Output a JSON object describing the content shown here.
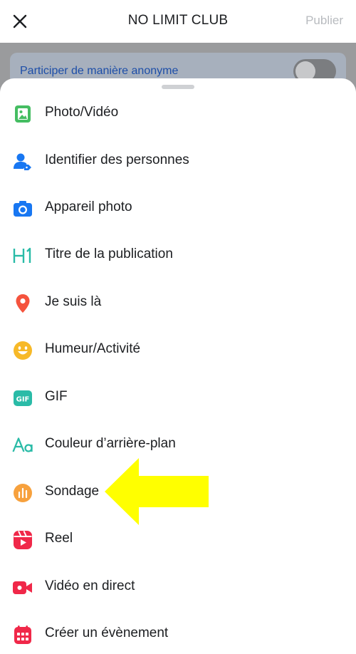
{
  "header": {
    "title": "NO LIMIT CLUB",
    "publish_label": "Publier"
  },
  "anonymous": {
    "label": "Participer de manière anonyme",
    "enabled": false
  },
  "menu": {
    "items": [
      {
        "label": "Photo/Vidéo",
        "icon": "photo-video-icon",
        "color": "#45bd62"
      },
      {
        "label": "Identifier des personnes",
        "icon": "tag-people-icon",
        "color": "#1877f2"
      },
      {
        "label": "Appareil photo",
        "icon": "camera-icon",
        "color": "#1877f2"
      },
      {
        "label": "Titre de la publication",
        "icon": "heading-icon",
        "color": "#2abba7"
      },
      {
        "label": "Je suis là",
        "icon": "location-pin-icon",
        "color": "#f5533d"
      },
      {
        "label": "Humeur/Activité",
        "icon": "feeling-icon",
        "color": "#f7b928"
      },
      {
        "label": "GIF",
        "icon": "gif-icon",
        "color": "#2abba7"
      },
      {
        "label": "Couleur d’arrière-plan",
        "icon": "background-color-icon",
        "color": "#2abba7"
      },
      {
        "label": "Sondage",
        "icon": "poll-icon",
        "color": "#f7a13d"
      },
      {
        "label": "Reel",
        "icon": "reel-icon",
        "color": "#f02849"
      },
      {
        "label": "Vidéo en direct",
        "icon": "live-video-icon",
        "color": "#f02849"
      },
      {
        "label": "Créer un évènement",
        "icon": "event-icon",
        "color": "#f02849"
      }
    ]
  },
  "annotation": {
    "icon": "yellow-arrow-icon",
    "color": "#ffff00"
  }
}
